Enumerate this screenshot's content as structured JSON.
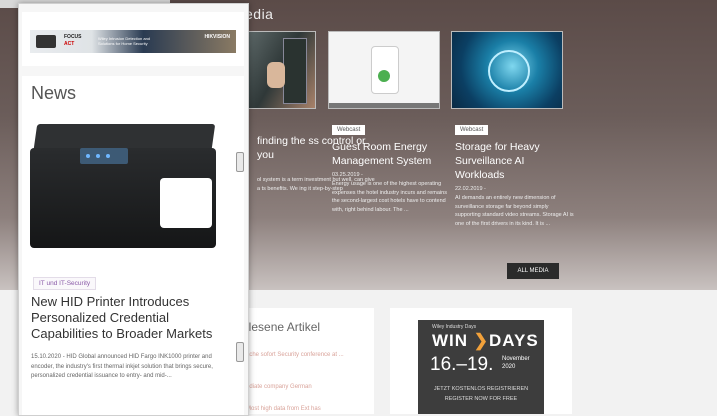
{
  "media_section": {
    "title": "edia",
    "all_media_label": "ALL MEDIA",
    "cards": [
      {
        "tag": "",
        "title": "finding the ss control or you",
        "date": "",
        "desc": "ol system is a term investment but well, can give a ts benefits. We ing it step-by-step"
      },
      {
        "tag": "Webcast",
        "title": "Guest Room Energy Management System",
        "date": "03.25.2019 -",
        "desc": "Energy usage is one of the highest operating expenses the hotel industry incurs and remains the second-largest cost hotels have to contend with, right behind labour. The ..."
      },
      {
        "tag": "Webcast",
        "title": "Storage for Heavy Surveillance AI Workloads",
        "date": "22.02.2019 -",
        "desc": "AI demands an entirely new dimension of surveillance storage far beyond simply supporting standard video streams. Storage AI is one of the first drivers in its kind. It is ..."
      }
    ]
  },
  "read_box": {
    "heading": "elesene Artikel",
    "links": [
      "ache sofort Security conference at ...",
      "ediate company German",
      "Most high data from Ext has"
    ]
  },
  "ad_windays": {
    "pre": "Wiley Industry Days",
    "win": "WIN",
    "days": "DAYS",
    "dates": "16.–19.",
    "month_year": "November 2020",
    "cta1": "JETZT KOSTENLOS REGISTRIEREN",
    "cta2": "REGISTER NOW FOR FREE"
  },
  "panel": {
    "banner": {
      "brand": "FOCUS",
      "brand2": "ACT",
      "text": "Wiley Intrusion Detection and Solutions for Home Security",
      "right": "HIKVISION"
    },
    "news_heading": "News",
    "article": {
      "tag": "IT und IT-Security",
      "title": "New HID Printer Introduces Personalized Credential Capabilities to Broader Markets",
      "body": "15.10.2020 - HID Global announced HID Fargo INK1000 printer and encoder, the industry's first thermal inkjet solution that brings secure, personalized credential issuance to entry- and mid-..."
    }
  },
  "colors": {
    "accent_tag": "#8a5aa8",
    "ad_accent": "#f2a13a",
    "button_dark": "#2b2b2b"
  }
}
